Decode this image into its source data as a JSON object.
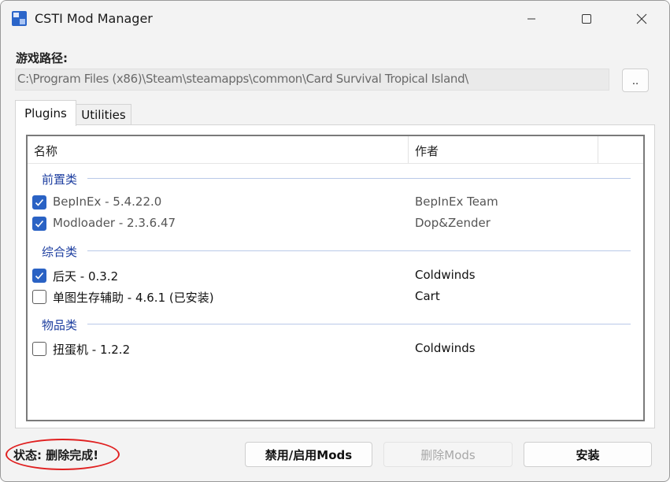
{
  "window": {
    "title": "CSTI Mod Manager"
  },
  "game_path": {
    "label": "游戏路径:",
    "value": "C:\\Program Files (x86)\\Steam\\steamapps\\common\\Card Survival Tropical Island\\",
    "browse_label": ".."
  },
  "tabs": [
    {
      "label": "Plugins",
      "active": true
    },
    {
      "label": "Utilities",
      "active": false
    }
  ],
  "list": {
    "columns": [
      "名称",
      "作者"
    ],
    "groups": [
      {
        "title": "前置类",
        "items": [
          {
            "name": "BepInEx - 5.4.22.0",
            "author": "BepInEx Team",
            "checked": true
          },
          {
            "name": "Modloader - 2.3.6.47",
            "author": "Dop&Zender",
            "checked": true
          }
        ]
      },
      {
        "title": "综合类",
        "items": [
          {
            "name": "后天 - 0.3.2",
            "author": "Coldwinds",
            "checked": true
          },
          {
            "name": "单图生存辅助 - 4.6.1 (已安装)",
            "author": "Cart",
            "checked": false
          }
        ]
      },
      {
        "title": "物品类",
        "items": [
          {
            "name": "扭蛋机 - 1.2.2",
            "author": "Coldwinds",
            "checked": false
          }
        ]
      }
    ]
  },
  "status": {
    "text": "状态: 删除完成!"
  },
  "buttons": {
    "toggle_label": "禁用/启用Mods",
    "delete_label": "删除Mods",
    "install_label": "安装"
  },
  "colors": {
    "accent": "#2a62c4",
    "group_title": "#1e3fa0",
    "highlight_ellipse": "#e02020"
  }
}
